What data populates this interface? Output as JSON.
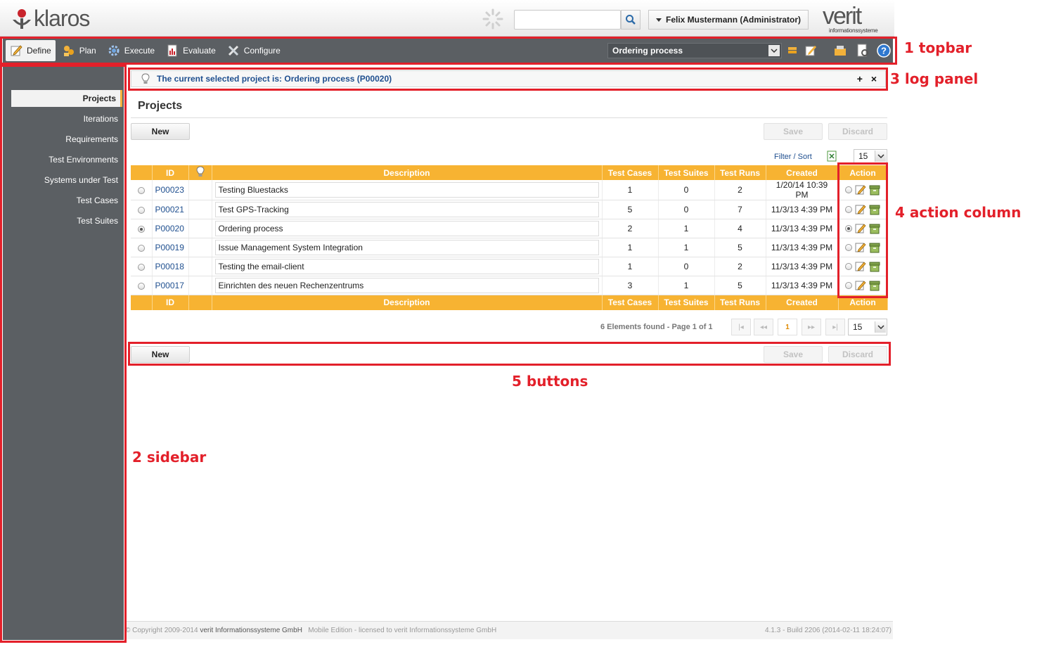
{
  "header": {
    "logo_text": "klaros",
    "user_menu": "Felix Mustermann (Administrator)",
    "brand_text": "verit",
    "brand_subtext": "informationssysteme",
    "search": {
      "value": "",
      "placeholder": ""
    }
  },
  "topbar": {
    "items": [
      {
        "label": "Define",
        "icon": "define-icon"
      },
      {
        "label": "Plan",
        "icon": "plan-icon"
      },
      {
        "label": "Execute",
        "icon": "execute-icon"
      },
      {
        "label": "Evaluate",
        "icon": "evaluate-icon"
      },
      {
        "label": "Configure",
        "icon": "configure-icon"
      }
    ],
    "active": "Define",
    "project_select": "Ordering process"
  },
  "sidebar": {
    "items": [
      "Projects",
      "Iterations",
      "Requirements",
      "Test Environments",
      "Systems under Test",
      "Test Cases",
      "Test Suites"
    ],
    "active": "Projects"
  },
  "log_panel": {
    "message": "The current selected project is: Ordering process (P00020)",
    "expand": "+",
    "close": "×"
  },
  "main": {
    "title": "Projects",
    "buttons": {
      "new": "New",
      "save": "Save",
      "discard": "Discard"
    },
    "filter_link": "Filter / Sort",
    "page_size": "15"
  },
  "table": {
    "columns": [
      "ID",
      "Description",
      "Test Cases",
      "Test Suites",
      "Test Runs",
      "Created",
      "Action"
    ],
    "rows": [
      {
        "id": "P00023",
        "description": "Testing Bluestacks",
        "test_cases": "1",
        "test_suites": "0",
        "test_runs": "2",
        "created": "1/20/14 10:39 PM",
        "selected": false
      },
      {
        "id": "P00021",
        "description": "Test GPS-Tracking",
        "test_cases": "5",
        "test_suites": "0",
        "test_runs": "7",
        "created": "11/3/13 4:39 PM",
        "selected": false
      },
      {
        "id": "P00020",
        "description": "Ordering process",
        "test_cases": "2",
        "test_suites": "1",
        "test_runs": "4",
        "created": "11/3/13 4:39 PM",
        "selected": true
      },
      {
        "id": "P00019",
        "description": "Issue Management System Integration",
        "test_cases": "1",
        "test_suites": "1",
        "test_runs": "5",
        "created": "11/3/13 4:39 PM",
        "selected": false
      },
      {
        "id": "P00018",
        "description": "Testing the email-client",
        "test_cases": "1",
        "test_suites": "0",
        "test_runs": "2",
        "created": "11/3/13 4:39 PM",
        "selected": false
      },
      {
        "id": "P00017",
        "description": "Einrichten des neuen Rechenzentrums",
        "test_cases": "3",
        "test_suites": "1",
        "test_runs": "5",
        "created": "11/3/13 4:39 PM",
        "selected": false
      }
    ]
  },
  "pagination": {
    "info": "6 Elements found - Page 1 of 1",
    "first": "|◂",
    "prev": "◂◂",
    "current": "1",
    "next": "▸▸",
    "last": "▸|",
    "page_size": "15"
  },
  "footer": {
    "prefix": "© Copyright 2009-2014",
    "company": "verit Informationssysteme GmbH",
    "edition": "Mobile Edition - licensed to verit Informationssysteme GmbH",
    "build": "4.1.3 - Build 2206 (2014-02-11 18:24:07)"
  },
  "annotations": {
    "topbar": "1 topbar",
    "sidebar": "2 sidebar",
    "log_panel": "3 log panel",
    "action_column": "4 action column",
    "buttons": "5 buttons"
  },
  "colors": {
    "accent": "#f7b332",
    "bar": "#5b5f63",
    "link": "#1f4f8f",
    "annotation": "#e3202a"
  }
}
